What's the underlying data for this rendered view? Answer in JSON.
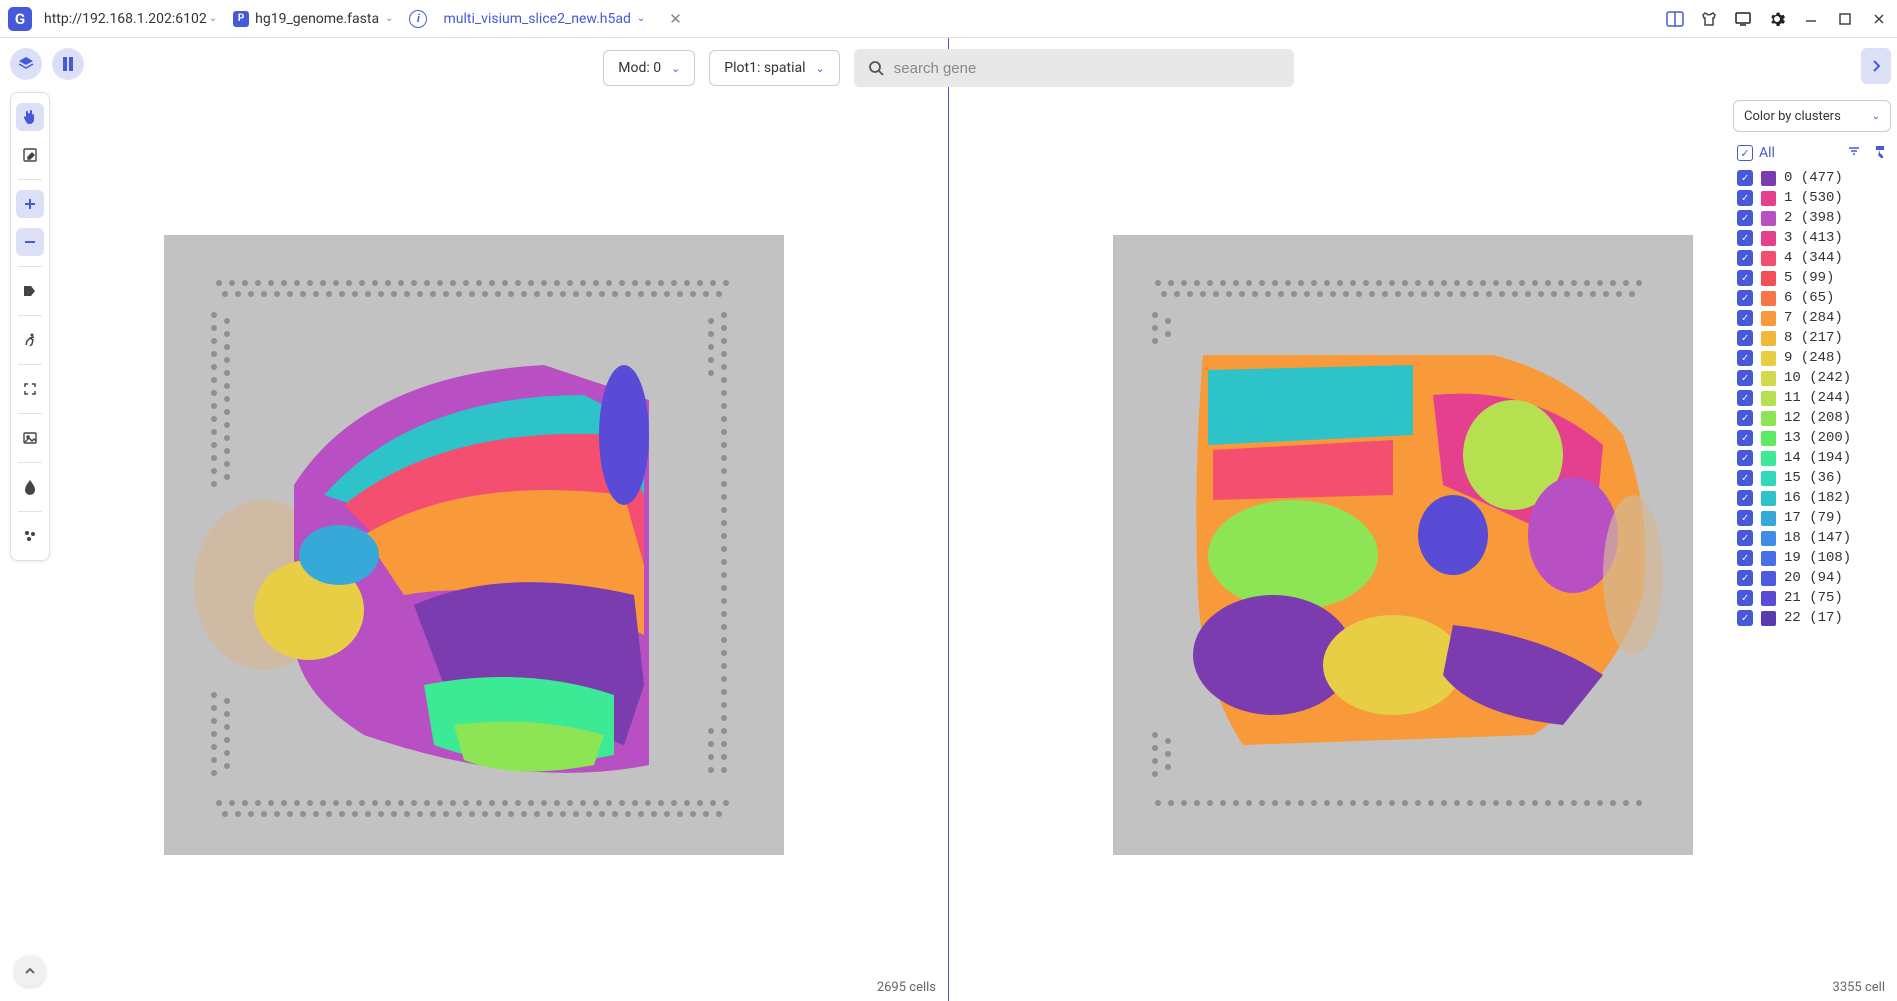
{
  "app": {
    "logo_letter": "G"
  },
  "header": {
    "url": "http://192.168.1.202:6102",
    "tabs": [
      {
        "badge": "P",
        "label": "hg19_genome.fasta",
        "active": false
      },
      {
        "label": "multi_visium_slice2_new.h5ad",
        "active": true
      }
    ]
  },
  "toolbar": {
    "mod_label": "Mod: 0",
    "plot_label": "Plot1: spatial",
    "search_placeholder": "search gene"
  },
  "panels": {
    "left": {
      "cell_count": "2695 cells"
    },
    "right": {
      "cell_count": "3355 cell"
    }
  },
  "cluster_panel": {
    "color_by": "Color by clusters",
    "all_label": "All",
    "clusters": [
      {
        "id": "0",
        "count": "477",
        "color": "#7b3cb0"
      },
      {
        "id": "1",
        "count": "530",
        "color": "#e5408e"
      },
      {
        "id": "2",
        "count": "398",
        "color": "#b84fc2"
      },
      {
        "id": "3",
        "count": "413",
        "color": "#e5408e"
      },
      {
        "id": "4",
        "count": "344",
        "color": "#f44e70"
      },
      {
        "id": "5",
        "count": "99",
        "color": "#f44e56"
      },
      {
        "id": "6",
        "count": "65",
        "color": "#f97545"
      },
      {
        "id": "7",
        "count": "284",
        "color": "#f99a3a"
      },
      {
        "id": "8",
        "count": "217",
        "color": "#f2b83c"
      },
      {
        "id": "9",
        "count": "248",
        "color": "#e8ce45"
      },
      {
        "id": "10",
        "count": "242",
        "color": "#d2d94a"
      },
      {
        "id": "11",
        "count": "244",
        "color": "#b6e04f"
      },
      {
        "id": "12",
        "count": "208",
        "color": "#8de556"
      },
      {
        "id": "13",
        "count": "200",
        "color": "#5de963"
      },
      {
        "id": "14",
        "count": "194",
        "color": "#3ce994"
      },
      {
        "id": "15",
        "count": "36",
        "color": "#2fd9ba"
      },
      {
        "id": "16",
        "count": "182",
        "color": "#2ec2c9"
      },
      {
        "id": "17",
        "count": "79",
        "color": "#36a9d9"
      },
      {
        "id": "18",
        "count": "147",
        "color": "#3f8de6"
      },
      {
        "id": "19",
        "count": "108",
        "color": "#476fe6"
      },
      {
        "id": "20",
        "count": "94",
        "color": "#4f59e0"
      },
      {
        "id": "21",
        "count": "75",
        "color": "#5a4bd6"
      },
      {
        "id": "22",
        "count": "17",
        "color": "#5a3cb0"
      }
    ]
  }
}
